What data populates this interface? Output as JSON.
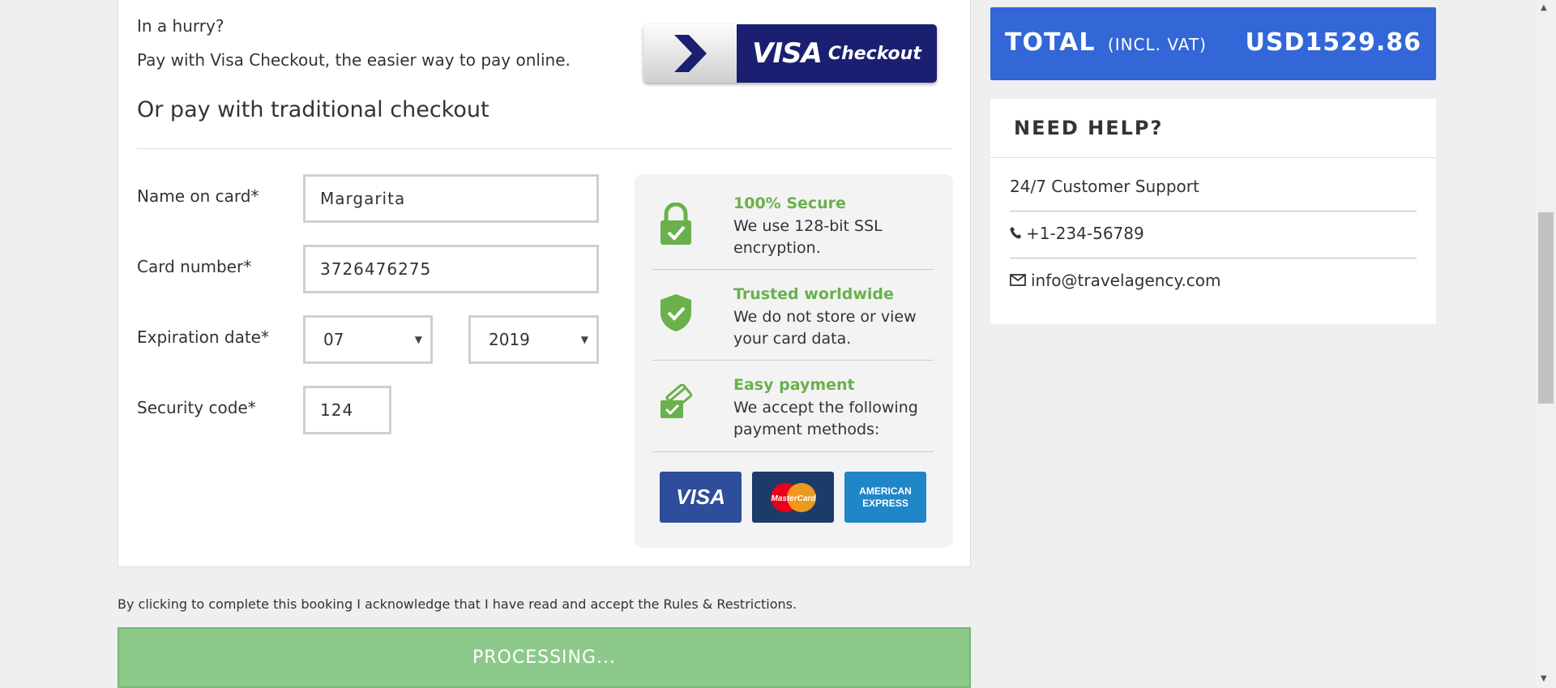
{
  "visa_checkout": {
    "hurry_text": "In a hurry?",
    "sub_text": "Pay with Visa Checkout, the easier way to pay online.",
    "button_visa": "VISA",
    "button_checkout": "Checkout"
  },
  "traditional_heading": "Or pay with traditional checkout",
  "form": {
    "name_label": "Name on card*",
    "name_value": "Margarita",
    "card_label": "Card number*",
    "card_value": "3726476275",
    "expiry_label": "Expiration date*",
    "expiry_month": "07",
    "expiry_year": "2019",
    "security_label": "Security code*",
    "security_value": "124"
  },
  "secure": {
    "items": [
      {
        "title": "100% Secure",
        "desc": "We use 128-bit SSL encryption.",
        "icon": "lock-icon"
      },
      {
        "title": "Trusted worldwide",
        "desc": "We do not store or view your card data.",
        "icon": "shield-check-icon"
      },
      {
        "title": "Easy payment",
        "desc": "We accept the following payment methods:",
        "icon": "credit-card-check-icon"
      }
    ],
    "methods": [
      "VISA",
      "MasterCard",
      "AMERICAN EXPRESS"
    ]
  },
  "acknowledge_text": "By clicking to complete this booking I acknowledge that I have read and accept the Rules & Restrictions.",
  "processing_label": "PROCESSING...",
  "summary": {
    "total_label": "TOTAL",
    "total_incl": "(INCL. VAT)",
    "total_amount": "USD1529.86"
  },
  "help": {
    "title": "NEED HELP?",
    "support": "24/7 Customer Support",
    "phone": "+1-234-56789",
    "email": "info@travelagency.com"
  },
  "colors": {
    "accent_blue": "#3366d6",
    "secure_green": "#6ab04c",
    "processing_green": "#8cc98a",
    "visa_navy": "#1a1f71"
  }
}
